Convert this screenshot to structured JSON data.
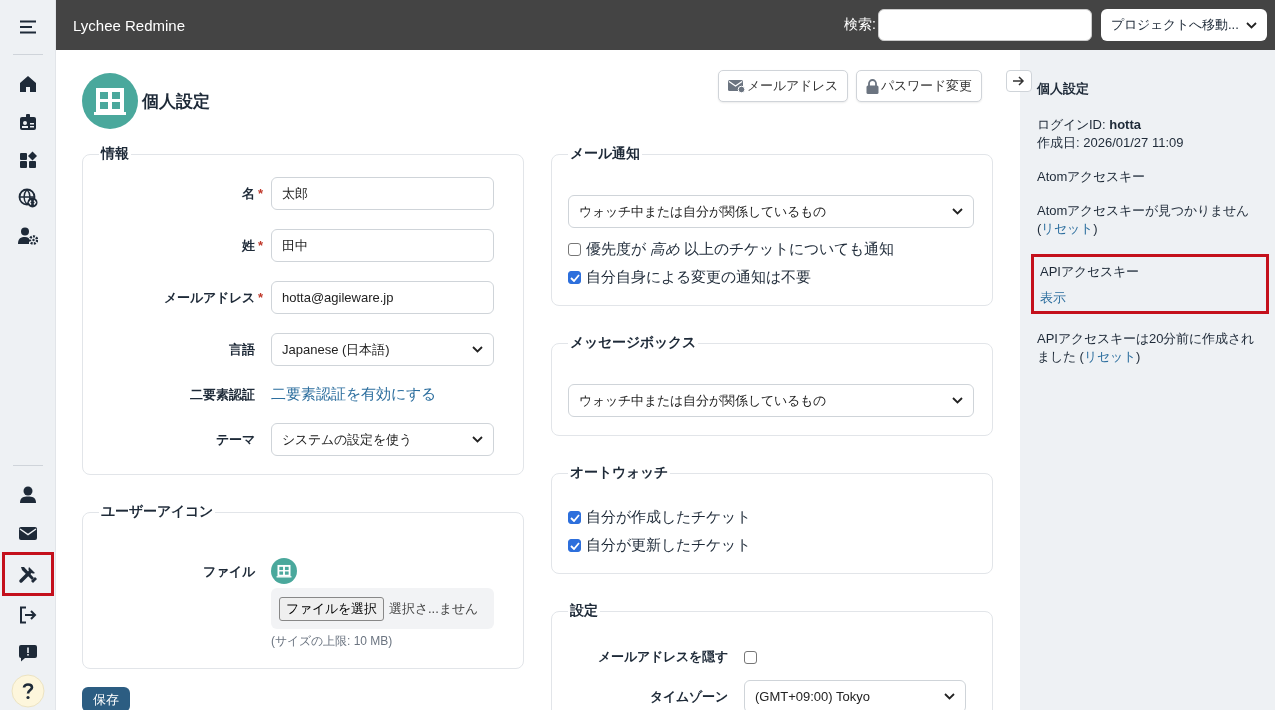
{
  "header": {
    "title": "Lychee Redmine",
    "search_label": "検索:",
    "project_jump": "プロジェクトへ移動..."
  },
  "sidebar": {
    "top_items": [
      {
        "kind": "home",
        "highlighted": false
      },
      {
        "kind": "id-card",
        "highlighted": false
      },
      {
        "kind": "apps",
        "highlighted": false
      },
      {
        "kind": "globe",
        "highlighted": false
      },
      {
        "kind": "user-gear",
        "highlighted": false
      }
    ],
    "bottom_items": [
      {
        "kind": "user",
        "highlighted": false
      },
      {
        "kind": "mail",
        "highlighted": false
      },
      {
        "kind": "tools",
        "highlighted": true
      },
      {
        "kind": "logout",
        "highlighted": false
      },
      {
        "kind": "feedback",
        "highlighted": false
      },
      {
        "kind": "help",
        "highlighted": false
      }
    ]
  },
  "page": {
    "title": "個人設定",
    "actions": [
      {
        "kind": "mail",
        "label": "メールアドレス"
      },
      {
        "kind": "lock",
        "label": "パスワード変更"
      }
    ]
  },
  "info_section": {
    "title": "情報",
    "required_mark": "*",
    "fields": [
      {
        "kind": "text",
        "label": "名",
        "required": true,
        "value": "太郎"
      },
      {
        "kind": "text",
        "label": "姓",
        "required": true,
        "value": "田中"
      },
      {
        "kind": "text",
        "label": "メールアドレス",
        "required": true,
        "value": "hotta@agileware.jp"
      },
      {
        "kind": "select",
        "label": "言語",
        "required": false,
        "value": "Japanese (日本語)"
      },
      {
        "kind": "link",
        "label": "二要素認証",
        "required": false,
        "value": "二要素認証を有効にする"
      },
      {
        "kind": "select",
        "label": "テーマ",
        "required": false,
        "value": "システムの設定を使う"
      }
    ]
  },
  "icon_section": {
    "title": "ユーザーアイコン",
    "label": "ファイル",
    "file_button": "ファイルを選択",
    "file_status": "選択さ...ません",
    "hint": "(サイズの上限: 10 MB)"
  },
  "save_button": "保存",
  "mail_section": {
    "title": "メール通知",
    "select": "ウォッチ中または自分が関係しているもの",
    "options": [
      {
        "label": "優先度が *高め* 以上のチケットについても通知",
        "checked": false
      },
      {
        "label": "自分自身による変更の通知は不要",
        "checked": true
      }
    ]
  },
  "messagebox_section": {
    "title": "メッセージボックス",
    "select": "ウォッチ中または自分が関係しているもの"
  },
  "autowatch_section": {
    "title": "オートウォッチ",
    "options": [
      {
        "label": "自分が作成したチケット",
        "checked": true
      },
      {
        "label": "自分が更新したチケット",
        "checked": true
      }
    ]
  },
  "settings_section": {
    "title": "設定",
    "hide_mail_label": "メールアドレスを隠す",
    "hide_mail": false,
    "timezone_label": "タイムゾーン",
    "timezone": "(GMT+09:00) Tokyo"
  },
  "side_panel": {
    "title": "個人設定",
    "login": "ログインID: **hotta**",
    "created": "作成日: 2026/01/27 11:09",
    "atom_title": "Atomアクセスキー",
    "atom_status": {
      "before": "Atomアクセスキーが見つかりません (",
      "link": "リセット",
      "after": ")"
    },
    "api_block": {
      "title": "APIアクセスキー",
      "link": "表示",
      "highlighted": true
    },
    "api_status": {
      "before": "APIアクセスキーは20分前に作成されました (",
      "link": "リセット",
      "after": ")"
    }
  }
}
